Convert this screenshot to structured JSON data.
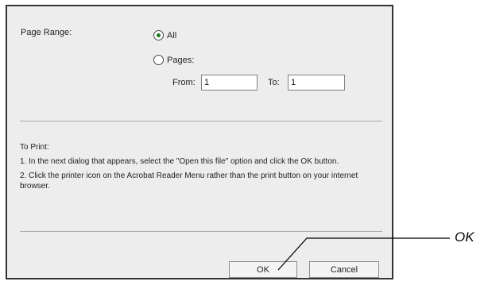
{
  "page_range": {
    "label": "Page Range:",
    "options": [
      {
        "label": "All",
        "selected": true
      },
      {
        "label": "Pages:",
        "selected": false
      }
    ],
    "from_label": "From:",
    "from_value": "1",
    "to_label": "To:",
    "to_value": "1"
  },
  "instructions": {
    "heading": "To Print:",
    "step1": "1. In the next dialog that appears, select the \"Open this file\" option and click the OK button.",
    "step2": "2. Click the printer icon on the Acrobat Reader Menu rather than the print button on your internet browser."
  },
  "buttons": {
    "ok_label": "OK",
    "cancel_label": "Cancel"
  },
  "callout": {
    "label": "OK"
  },
  "colors": {
    "dialog_background": "#ededed",
    "radio_selected": "#1f7a1f"
  }
}
